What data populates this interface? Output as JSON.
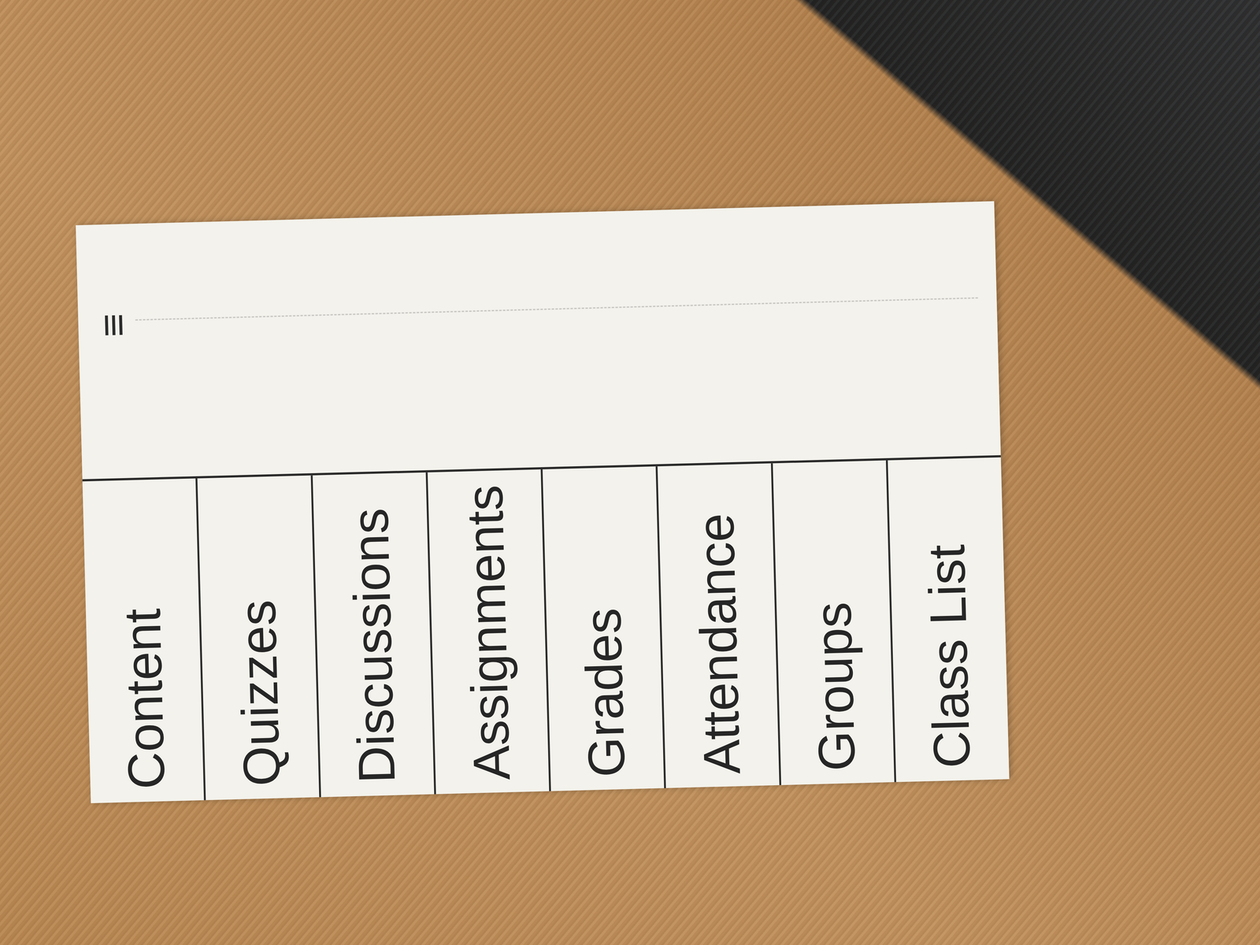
{
  "menu": {
    "icon": "≡"
  },
  "sidebar": {
    "items": [
      {
        "label": "Content"
      },
      {
        "label": "Quizzes"
      },
      {
        "label": "Discussions"
      },
      {
        "label": "Assignments"
      },
      {
        "label": "Grades"
      },
      {
        "label": "Attendance"
      },
      {
        "label": "Groups"
      },
      {
        "label": "Class List"
      }
    ]
  }
}
